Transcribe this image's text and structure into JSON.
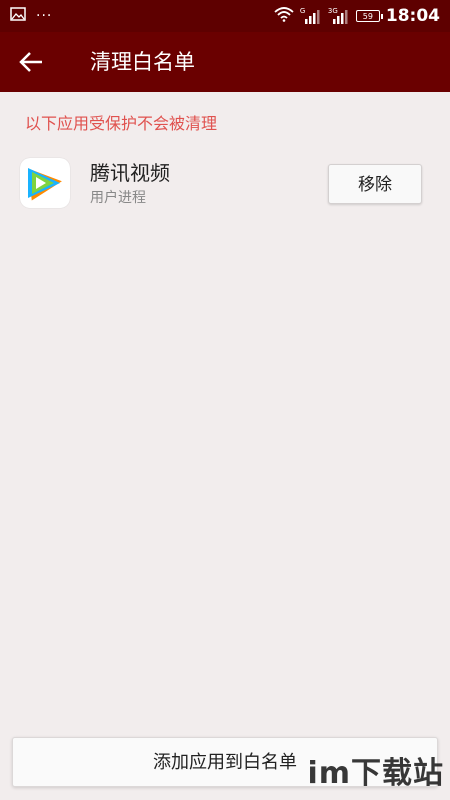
{
  "status_bar": {
    "dots": "···",
    "sim1": "G",
    "sim2": "3G",
    "battery": "59",
    "time": "18:04"
  },
  "app_bar": {
    "title": "清理白名单"
  },
  "notice": "以下应用受保护不会被清理",
  "whitelist": [
    {
      "name": "腾讯视频",
      "subtitle": "用户进程",
      "action": "移除"
    }
  ],
  "add_button": "添加应用到白名单",
  "watermark": "im下载站",
  "colors": {
    "status_bar": "#5e0000",
    "app_bar": "#6a0000",
    "background": "#f2eded",
    "notice_text": "#e0524f"
  },
  "icons": [
    "image-icon",
    "wifi-icon",
    "signal-icon",
    "battery-icon",
    "back-arrow-icon",
    "tencent-video-icon"
  ]
}
